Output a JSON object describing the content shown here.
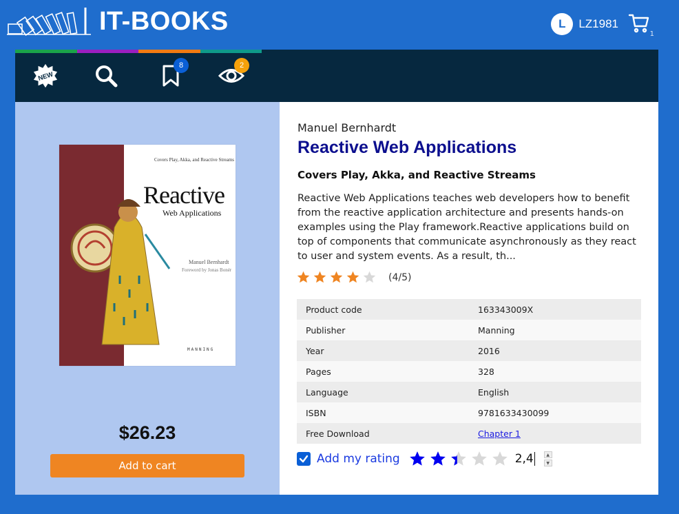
{
  "header": {
    "brand": "IT-BOOKS",
    "avatar_initial": "L",
    "username": "LZ1981",
    "cart_count": "1"
  },
  "nav": {
    "items": [
      {
        "name": "new",
        "icon": "new-badge-icon",
        "label": "NEW"
      },
      {
        "name": "search",
        "icon": "search-icon"
      },
      {
        "name": "bookmarks",
        "icon": "bookmark-icon",
        "badge": "8"
      },
      {
        "name": "viewed",
        "icon": "eye-icon",
        "badge": "2"
      }
    ],
    "strip_colors": [
      "#1aa34a",
      "#9b1fc0",
      "#f07a12",
      "#0f9a8a"
    ]
  },
  "book": {
    "cover": {
      "subtitle": "Covers Play, Akka, and Reactive Streams",
      "title_line1": "Reactive",
      "title_line2": "Web Applications",
      "author": "Manuel Bernhardt",
      "foreword": "Foreword by Jonas Bonér",
      "publisher": "MANNING"
    },
    "price": "$26.23",
    "add_to_cart": "Add to cart",
    "author": "Manuel Bernhardt",
    "title": "Reactive Web Applications",
    "subtitle": "Covers Play, Akka, and Reactive Streams",
    "description": "Reactive Web Applications teaches web developers how to benefit from the reactive application architecture and presents hands-on examples using the Play framework.Reactive applications build on top of components that communicate asynchronously as they react to user and system events. As a result, th...",
    "rating": 4,
    "rating_text": "(4/5)",
    "details": [
      {
        "label": "Product code",
        "value": "163343009X"
      },
      {
        "label": "Publisher",
        "value": "Manning"
      },
      {
        "label": "Year",
        "value": "2016"
      },
      {
        "label": "Pages",
        "value": "328"
      },
      {
        "label": "Language",
        "value": "English"
      },
      {
        "label": "ISBN",
        "value": "9781633430099"
      },
      {
        "label": "Free Download",
        "value": "Chapter 1"
      }
    ],
    "my_rating": {
      "label": "Add my rating",
      "checked": true,
      "value": "2,4"
    }
  },
  "colors": {
    "background": "#1f6dcd",
    "nav": "#06283f",
    "left_panel": "#afc7f0",
    "title": "#0c0f8e",
    "button": "#ef8522",
    "star_orange": "#ef8522",
    "star_blue": "#0000f0",
    "badge_blue": "#0a5fd6",
    "badge_orange": "#f5a10b"
  }
}
